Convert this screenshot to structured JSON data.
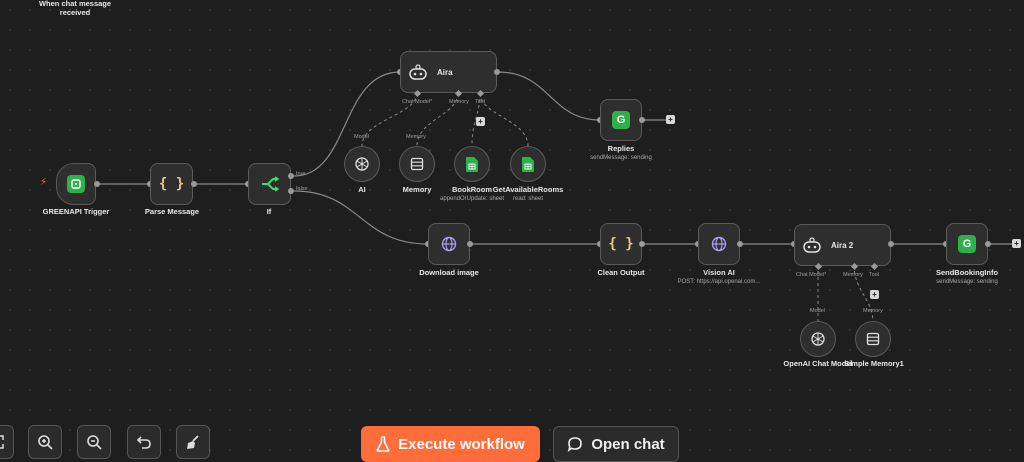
{
  "canvas": {
    "accent": "#ff6d3a",
    "green": "#2fb04c"
  },
  "top_note": "When chat message\nreceived",
  "nodes": {
    "greenapi_trigger": {
      "label": "GREENAPI Trigger",
      "icon": "greenapi-icon"
    },
    "parse_message": {
      "label": "Parse Message",
      "icon": "code-braces-icon"
    },
    "if": {
      "label": "If",
      "icon": "branch-icon",
      "true_label": "true",
      "false_label": "false"
    },
    "aira": {
      "label": "Aira",
      "icon": "robot-icon",
      "ports": {
        "chat_model": "Chat Model*",
        "memory": "Memory",
        "tool": "Tool"
      }
    },
    "ai": {
      "label": "AI",
      "sub_label_top": "Model",
      "icon": "openai-icon"
    },
    "memory": {
      "label": "Memory",
      "sub_label_top": "Memory",
      "icon": "database-icon"
    },
    "book_room": {
      "label": "BookRoom",
      "sub": "appendOrUpdate: sheet",
      "icon": "sheets-icon"
    },
    "get_rooms": {
      "label": "GetAvailableRooms",
      "sub": "read: sheet",
      "icon": "sheets-icon"
    },
    "replies": {
      "label": "Replies",
      "sub": "sendMessage: sending",
      "icon": "greenapi-icon"
    },
    "download_image": {
      "label": "Download image",
      "icon": "globe-icon"
    },
    "clean_output": {
      "label": "Clean Output",
      "icon": "code-braces-icon"
    },
    "vision_ai": {
      "label": "Vision AI",
      "sub": "POST: https://api.openai.com...",
      "icon": "globe-icon"
    },
    "aira2": {
      "label": "Aira 2",
      "icon": "robot-icon",
      "ports": {
        "chat_model": "Chat Model*",
        "memory": "Memory",
        "tool": "Tool"
      }
    },
    "openai_chat_model": {
      "label": "OpenAI Chat Model",
      "sub_label_top": "Model",
      "icon": "openai-icon"
    },
    "simple_memory": {
      "label": "Simple Memory1",
      "sub_label_top": "Memory",
      "icon": "database-icon"
    },
    "send_booking": {
      "label": "SendBookingInfo",
      "sub": "sendMessage: sending",
      "icon": "greenapi-icon"
    }
  },
  "toolbar": {
    "execute_label": "Execute workflow",
    "open_chat_label": "Open chat"
  }
}
